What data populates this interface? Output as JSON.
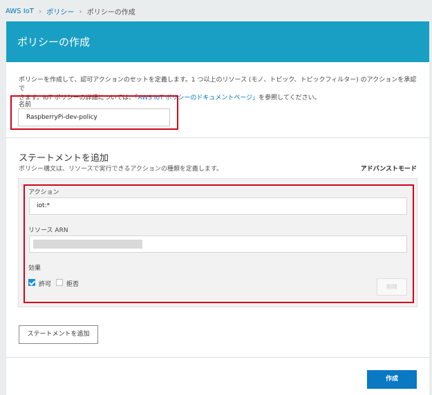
{
  "breadcrumb": {
    "root": "AWS IoT",
    "section": "ポリシー",
    "current": "ポリシーの作成"
  },
  "header": {
    "title": "ポリシーの作成"
  },
  "description": {
    "line1": "ポリシーを作成して、認可アクションのセットを定義します。1 つ以上のリソース (モノ、トピック、トピックフィルター) のアクションを承認で",
    "line2_prefix": "きます。IoT ポリシーの詳細については、",
    "link": "「AWS IoT ポリシーのドキュメントページ」",
    "line2_suffix": "を参照してください。"
  },
  "name": {
    "label": "名前",
    "value": "RaspberryPi-dev-policy"
  },
  "statement": {
    "title": "ステートメントを追加",
    "description": "ポリシー構文は、リソースで実行できるアクションの種類を定義します。",
    "advanced_mode": "アドバンストモード",
    "action_label": "アクション",
    "action_value": "iot:*",
    "resource_label": "リソース ARN",
    "effect_label": "効果",
    "allow_label": "許可",
    "allow_checked": true,
    "deny_label": "拒否",
    "deny_checked": false,
    "delete_label": "削除"
  },
  "add_statement_button": "ステートメントを追加",
  "create_button": "作成",
  "colors": {
    "header_bg": "#1a9fc4",
    "highlight": "#d0021b",
    "primary_button": "#0a78c2",
    "link": "#0073bb"
  }
}
